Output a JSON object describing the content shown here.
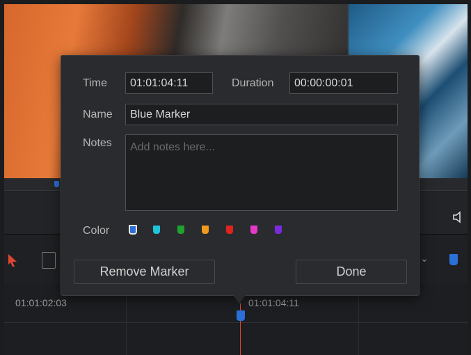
{
  "dialog": {
    "time_label": "Time",
    "time_value": "01:01:04:11",
    "duration_label": "Duration",
    "duration_value": "00:00:00:01",
    "name_label": "Name",
    "name_value": "Blue Marker",
    "notes_label": "Notes",
    "notes_placeholder": "Add notes here...",
    "color_label": "Color",
    "colors": [
      "#2b6fd8",
      "#20c4d8",
      "#1fa22f",
      "#f19a1b",
      "#e0231f",
      "#e43ac8",
      "#7a2be0"
    ],
    "selected_color": "#2b6fd8",
    "remove_label": "Remove Marker",
    "done_label": "Done"
  },
  "timeline": {
    "timecode_left": "01:01:02:03",
    "timecode_playhead": "01:01:04:11"
  },
  "icons": [
    "selection-arrow-icon",
    "trim-mode-icon",
    "chevron-down-icon",
    "marker-icon",
    "speaker-icon"
  ]
}
